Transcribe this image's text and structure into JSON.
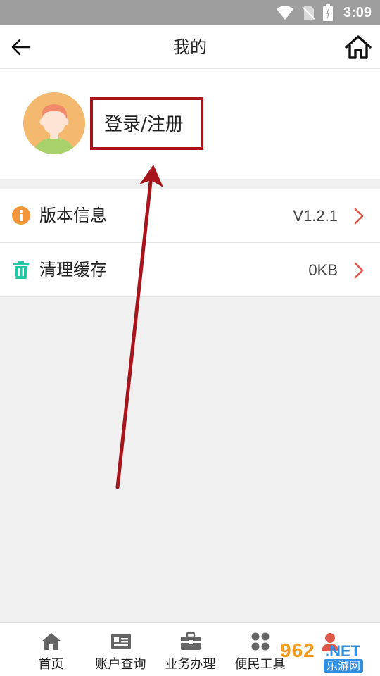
{
  "status_bar": {
    "time": "3:09"
  },
  "header": {
    "title": "我的"
  },
  "profile": {
    "login_label": "登录/注册"
  },
  "menu": {
    "items": [
      {
        "label": "版本信息",
        "value": "V1.2.1",
        "icon": "info-icon",
        "color": "#f5953b"
      },
      {
        "label": "清理缓存",
        "value": "0KB",
        "icon": "trash-icon",
        "color": "#22c7a3"
      }
    ]
  },
  "tabs": [
    {
      "label": "首页",
      "icon": "home-icon"
    },
    {
      "label": "账户查询",
      "icon": "id-card-icon"
    },
    {
      "label": "业务办理",
      "icon": "briefcase-icon"
    },
    {
      "label": "便民工具",
      "icon": "grid-icon"
    }
  ],
  "watermark": {
    "number": "962",
    "net": ".NET",
    "site": "乐游网"
  },
  "colors": {
    "annotation": "#a8141c",
    "chevron": "#e0584a",
    "tab_icon": "#666666"
  }
}
